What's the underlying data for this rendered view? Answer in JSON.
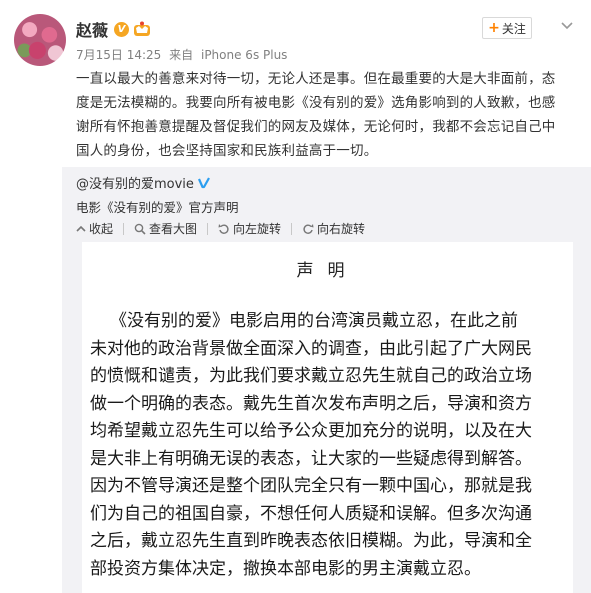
{
  "post": {
    "author": "赵薇",
    "date": "7月15日 14:25",
    "source_prefix": "来自",
    "source": "iPhone 6s Plus",
    "follow_label": "关注",
    "text_lines": [
      "一直以最大的善意来对待一切，无论人还是事。但在最重要的大是大非面前，态",
      "度是无法模糊的。我要向所有被电影《没有别的爱》选角影响到的人致歉，也感",
      "谢所有怀抱善意提醒及督促我们的网友及媒体，无论何时，我都不会忘记自己中",
      "国人的身份，也会坚持国家和民族利益高于一切。"
    ]
  },
  "repost": {
    "author": "@没有别的爱movie",
    "description": "电影《没有别的爱》官方声明",
    "actions": [
      {
        "label": "收起",
        "icon": "collapse-icon"
      },
      {
        "label": "查看大图",
        "icon": "zoom-icon"
      },
      {
        "label": "向左旋转",
        "icon": "rotate-left-icon"
      },
      {
        "label": "向右旋转",
        "icon": "rotate-right-icon"
      }
    ],
    "document": {
      "title": "声明",
      "lines": [
        "《没有别的爱》电影启用的台湾演员戴立忍，在此之前",
        "未对他的政治背景做全面深入的调查，由此引起了广大网民",
        "的愤慨和谴责，为此我们要求戴立忍先生就自己的政治立场",
        "做一个明确的表态。戴先生首次发布声明之后，导演和资方",
        "均希望戴立忍先生可以给予公众更加充分的说明，以及在大",
        "是大非上有明确无误的表态，让大家的一些疑虑得到解答。",
        "因为不管导演还是整个团队完全只有一颗中国心，那就是我",
        "们为自己的祖国自豪，不想任何人质疑和误解。但多次沟通",
        "之后，戴立忍先生直到昨晚表态依旧模糊。为此，导演和全",
        "部投资方集体决定，撤换本部电影的男主演戴立忍。"
      ]
    }
  },
  "colors": {
    "accent_orange": "#ff8200",
    "verified_badge": "#f5a623",
    "repost_bg": "#f2f2f5",
    "meta_gray": "#808080"
  }
}
